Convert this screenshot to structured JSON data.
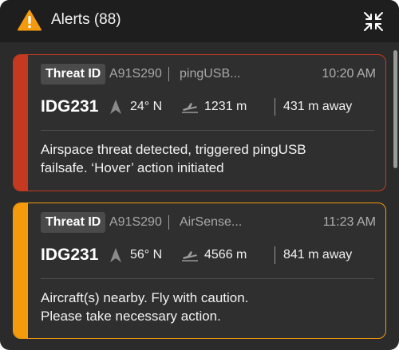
{
  "header": {
    "title": "Alerts (88)",
    "warning_icon": "warning-triangle-icon",
    "collapse_icon": "collapse-arrows-icon",
    "colors": {
      "warning": "#f59a0c",
      "background": "#1e1e1e"
    }
  },
  "alerts": [
    {
      "severity_color": "#c4391f",
      "threat_label": "Threat ID",
      "threat_id": "A91S290",
      "source": "pingUSB...",
      "time": "10:20 AM",
      "drone_id": "IDG231",
      "heading": "24° N",
      "altitude": "1231 m",
      "distance": "431 m away",
      "message_lines": [
        "Airspace threat detected, triggered pingUSB",
        "failsafe. ‘Hover’ action initiated"
      ]
    },
    {
      "severity_color": "#f59a0c",
      "threat_label": "Threat ID",
      "threat_id": "A91S290",
      "source": "AirSense...",
      "time": "11:23 AM",
      "drone_id": "IDG231",
      "heading": "56° N",
      "altitude": "4566 m",
      "distance": "841 m away",
      "message_lines": [
        "Aircraft(s) nearby. Fly with caution.",
        "Please take necessary action."
      ]
    }
  ]
}
